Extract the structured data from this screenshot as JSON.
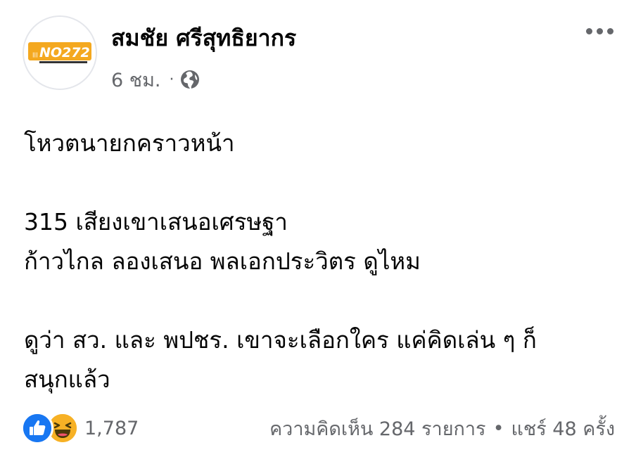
{
  "post": {
    "author": "สมชัย ศรีสุทธิยากร",
    "avatar_logo_text": "NO272",
    "timestamp": "6 ชม.",
    "privacy_icon": "globe-icon",
    "more_icon": "more-options-icon",
    "text_lines": [
      "โหวตนายกคราวหน้า",
      "315 เสียงเขาเสนอเศรษฐา",
      "ก้าวไกล ลองเสนอ พลเอกประวิตร ดูไหม",
      "ดูว่า สว. และ พปชร. เขาจะเลือกใคร   แค่คิดเล่น ๆ ก็",
      "สนุกแล้ว"
    ]
  },
  "footer": {
    "reaction_icons": [
      "like-icon",
      "haha-icon"
    ],
    "reaction_count": "1,787",
    "comments": "ความคิดเห็น 284 รายการ",
    "separator": "•",
    "shares": "แชร์ 48 ครั้ง"
  },
  "colors": {
    "like_blue": "#1877f2",
    "haha_yellow": "#f7b125",
    "secondary_text": "#65676b",
    "primary_text": "#050505"
  }
}
